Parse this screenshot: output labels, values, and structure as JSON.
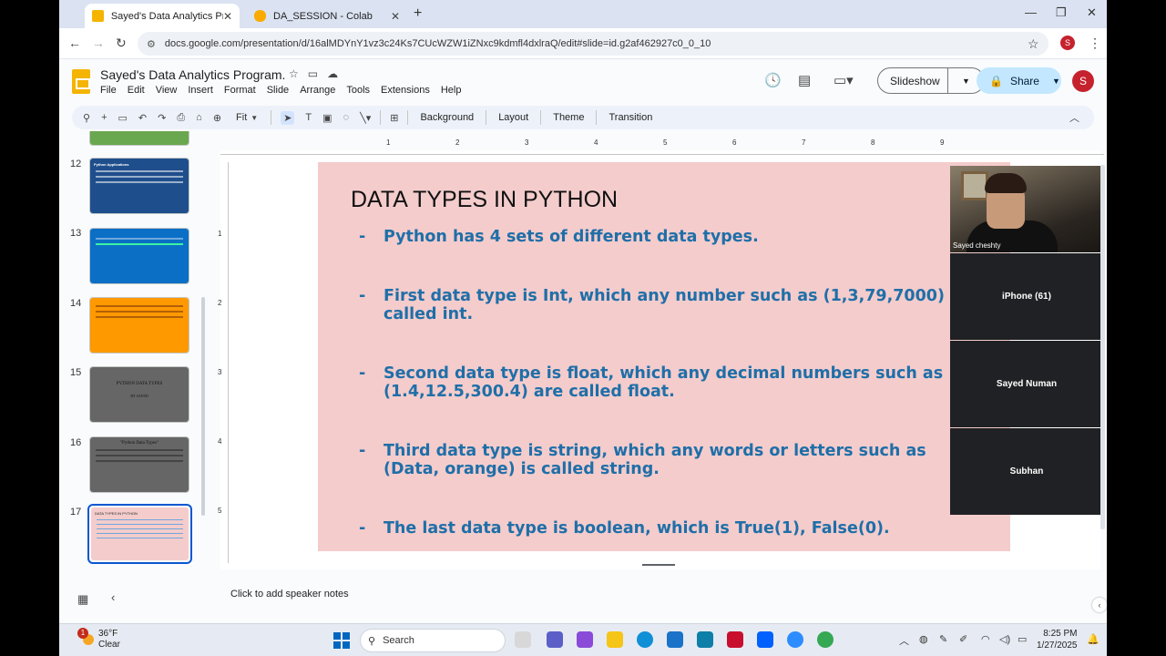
{
  "browser": {
    "tabs": [
      {
        "title": "Sayed's Data Analytics Program",
        "active": true
      },
      {
        "title": "DA_SESSION - Colab",
        "active": false
      }
    ],
    "url": "docs.google.com/presentation/d/16alMDYnY1vz3c24Ks7CUcWZW1iZNxc9kdmfl4dxlraQ/edit#slide=id.g2af462927c0_0_10",
    "profile_initial": "S"
  },
  "doc": {
    "title": "Sayed's Data Analytics Program.",
    "menu": [
      "File",
      "Edit",
      "View",
      "Insert",
      "Format",
      "Slide",
      "Arrange",
      "Tools",
      "Extensions",
      "Help"
    ],
    "slideshow_label": "Slideshow",
    "share_label": "Share",
    "avatar_initial": "S"
  },
  "toolbar": {
    "zoom": "Fit",
    "background": "Background",
    "layout": "Layout",
    "theme": "Theme",
    "transition": "Transition"
  },
  "filmstrip": {
    "numbers": [
      "12",
      "13",
      "14",
      "15",
      "16",
      "17"
    ],
    "thumb12_title": "Python Applications",
    "thumb15_title": "PYTHON DATA TYPES",
    "thumb15_sub": "BY SAYED",
    "thumb16_title": "\"Python Data Types\"",
    "thumb17_title": "DATA TYPES IN PYTHON",
    "selected": "17"
  },
  "ruler": {
    "h": [
      "1",
      "2",
      "3",
      "4",
      "5",
      "6",
      "7",
      "8",
      "9"
    ],
    "v": [
      "1",
      "2",
      "3",
      "4",
      "5"
    ]
  },
  "slide": {
    "title": "DATA TYPES IN PYTHON",
    "bullets": [
      "Python has 4 sets of different data types.",
      "First data type is Int, which any number such as (1,3,79,7000) called int.",
      "Second data type is float, which any decimal numbers such as (1.4,12.5,300.4) are called float.",
      "Third data type is string, which any words or letters such as (Data, orange) is called string.",
      "The last data type is boolean, which is True(1), False(0)."
    ],
    "dash": "-"
  },
  "participants": {
    "camera_name": "Sayed cheshty",
    "tiles": [
      "iPhone (61)",
      "Sayed Numan",
      "Subhan"
    ]
  },
  "notes": {
    "placeholder": "Click to add speaker notes"
  },
  "taskbar": {
    "weather_badge": "1",
    "temperature": "36°F",
    "condition": "Clear",
    "search": "Search",
    "time": "8:25 PM",
    "date": "1/27/2025"
  }
}
